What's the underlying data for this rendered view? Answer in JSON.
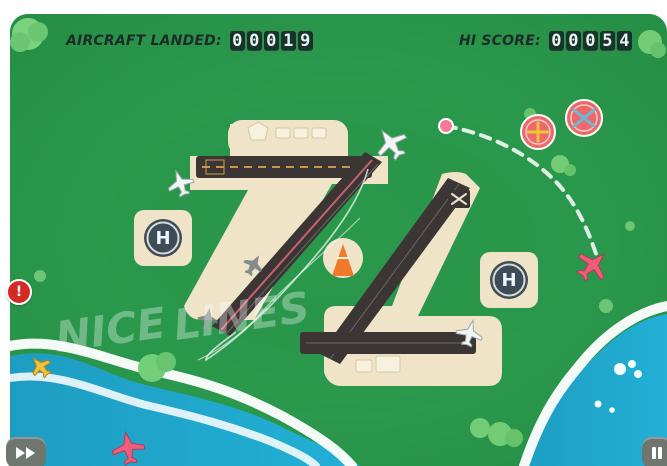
{
  "hud": {
    "left_label": "AIRCRAFT LANDED:",
    "left_digits": [
      "0",
      "0",
      "0",
      "1",
      "9"
    ],
    "right_label": "HI SCORE:",
    "right_digits": [
      "0",
      "0",
      "0",
      "5",
      "4"
    ]
  },
  "status": {
    "alert_mark": "!"
  },
  "watermark": {
    "line1": "NICE",
    "line2": "LINES"
  },
  "helipads": [
    "H",
    "H"
  ],
  "colors": {
    "grass": "#2d9e4c",
    "river": "#2aa8c9",
    "sand": "#efe4c8",
    "runway": "#3b3534"
  },
  "icons": [
    "fast-forward-icon",
    "pause-icon",
    "alert-icon",
    "helipad-icon",
    "airplane-icon",
    "warning-badge-icon",
    "cone-icon"
  ]
}
